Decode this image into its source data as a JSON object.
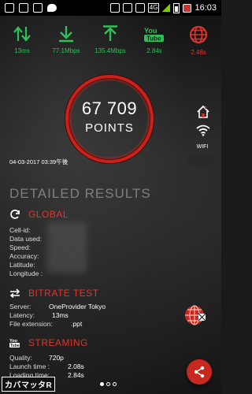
{
  "status_bar": {
    "time": "16:03",
    "network": "4G",
    "left_icons": [
      "mail-icon",
      "image-icon",
      "message-icon",
      "twitter-icon"
    ],
    "right_icons": [
      "no-sound-icon",
      "alarm-icon",
      "vibrate-icon",
      "signal-icon",
      "battery-icon",
      "alert-icon"
    ]
  },
  "metrics": [
    {
      "icon": "ping-arrows-icon",
      "value": "13ms",
      "color": "#2fbf5a"
    },
    {
      "icon": "download-arrow-icon",
      "value": "77.1Mbps",
      "color": "#2fbf5a"
    },
    {
      "icon": "upload-arrow-icon",
      "value": "135.4Mbps",
      "color": "#2fbf5a"
    },
    {
      "icon": "youtube-icon",
      "value": "2.84s",
      "color": "#2fbf5a"
    },
    {
      "icon": "web-globe-icon",
      "value": "2.48s",
      "color": "#e0352c"
    }
  ],
  "score": {
    "value": "67 709",
    "label": "POINTS",
    "ring_color": "#d4231b"
  },
  "side": {
    "wifi_label": "WIFI"
  },
  "timestamp": "04-03-2017 03:39午後",
  "detailed_heading": "DETAILED RESULTS",
  "global": {
    "title": "GLOBAL",
    "labels": [
      "Cell-id:",
      "Data used:",
      "Speed:",
      "Accuracy:",
      "Latitude:",
      "Longitude :"
    ]
  },
  "bitrate": {
    "title": "BITRATE TEST",
    "server_label": "Server:",
    "server_value": "OneProvider Tokyo",
    "latency_label": "Latency:",
    "latency_value": "13ms",
    "ext_label": "File extension:",
    "ext_value": ".ppt"
  },
  "streaming": {
    "title": "STREAMING",
    "quality_label": "Quality:",
    "quality_value": "720p",
    "launch_label": "Launch time :",
    "launch_value": "2.08s",
    "loading_label": "Loading time:",
    "loading_value": "2.84s"
  },
  "pager": {
    "count": 3,
    "active": 1
  },
  "watermark": "カバマッタR",
  "accent": "#e0352c"
}
